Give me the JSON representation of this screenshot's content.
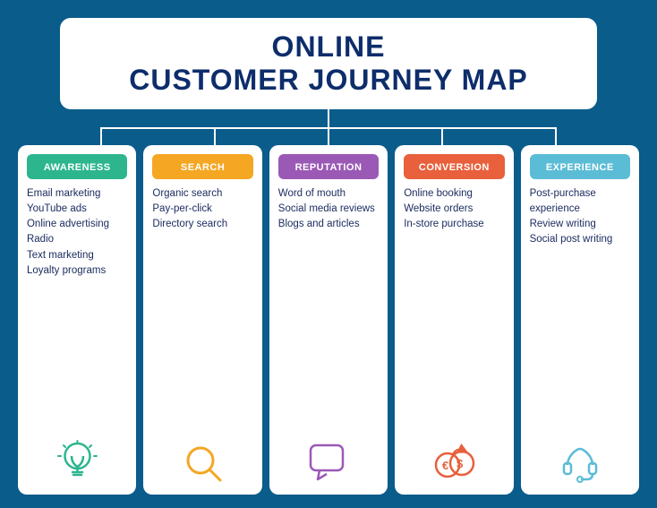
{
  "page": {
    "title_line1": "ONLINE",
    "title_line2": "CUSTOMER JOURNEY MAP",
    "background_color": "#0a5c8a"
  },
  "cards": [
    {
      "id": "awareness",
      "header": "AWARENESS",
      "header_class": "header-awareness",
      "items": [
        "Email marketing",
        "YouTube ads",
        "Online advertising",
        "Radio",
        "Text marketing",
        "Loyalty programs"
      ],
      "icon": "lightbulb"
    },
    {
      "id": "search",
      "header": "SEARCH",
      "header_class": "header-search",
      "items": [
        "Organic search",
        "Pay-per-click",
        "Directory search"
      ],
      "icon": "magnifier"
    },
    {
      "id": "reputation",
      "header": "REPUTATION",
      "header_class": "header-reputation",
      "items": [
        "Word of mouth",
        "Social media reviews",
        "Blogs and articles"
      ],
      "icon": "speech-bubble"
    },
    {
      "id": "conversion",
      "header": "CONVERSION",
      "header_class": "header-conversion",
      "items": [
        "Online booking",
        "Website orders",
        "In-store purchase"
      ],
      "icon": "coins"
    },
    {
      "id": "experience",
      "header": "EXPERIENCE",
      "header_class": "header-experience",
      "items": [
        "Post-purchase experience",
        "Review writing",
        "Social post writing"
      ],
      "icon": "headset"
    }
  ]
}
